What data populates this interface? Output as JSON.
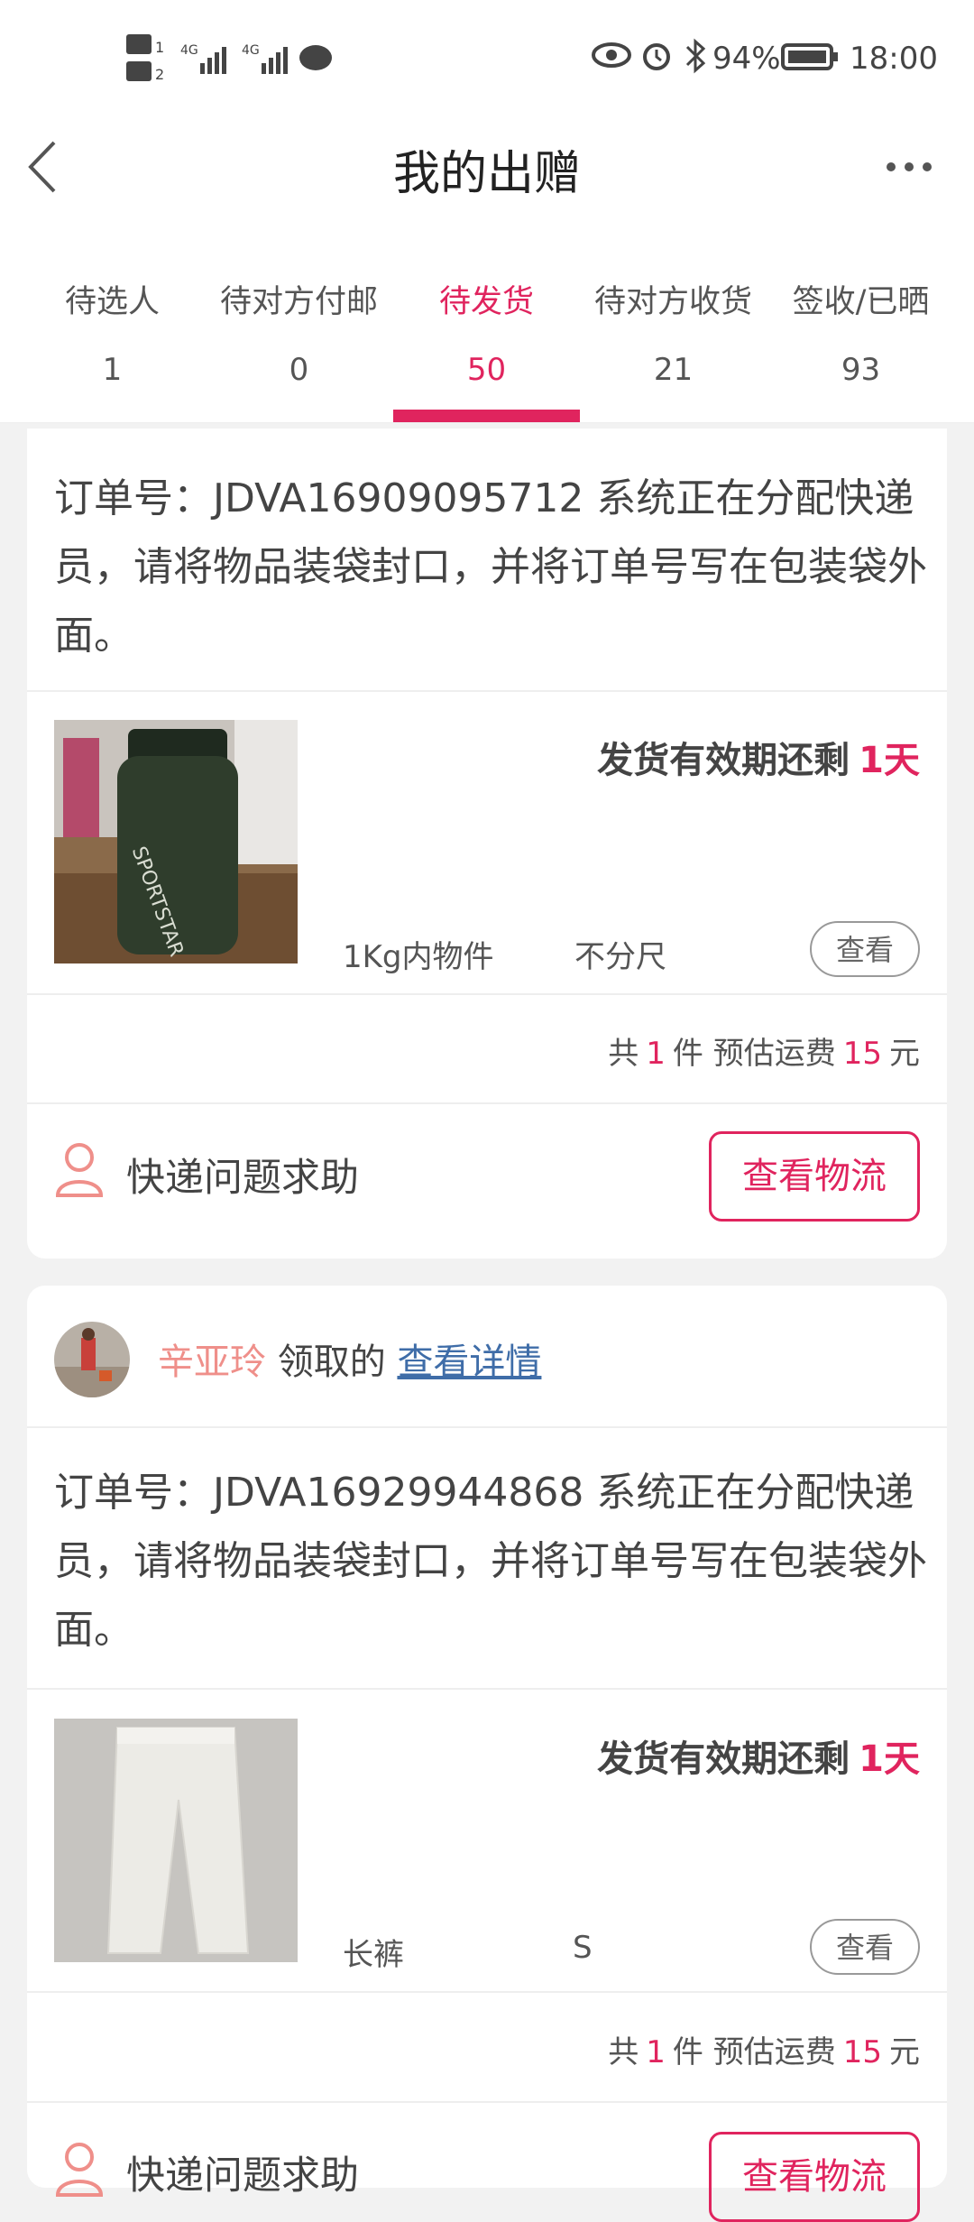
{
  "status_bar": {
    "network_left": "HD 4G 4G",
    "battery_percent": "94%",
    "time": "18:00"
  },
  "header": {
    "title": "我的出赠"
  },
  "tabs": [
    {
      "label": "待选人",
      "count": "1"
    },
    {
      "label": "待对方付邮",
      "count": "0"
    },
    {
      "label": "待发货",
      "count": "50",
      "active": true
    },
    {
      "label": "待对方收货",
      "count": "21"
    },
    {
      "label": "签收/已晒",
      "count": "93"
    }
  ],
  "orders": [
    {
      "order_text": "订单号：JDVA16909095712 系统正在分配快递员，请将物品装袋封口，并将订单号写在包装袋外面。",
      "expiry_label": "发货有效期还剩",
      "expiry_days": "1天",
      "spec_1": "1Kg内物件",
      "spec_2": "不分尺",
      "view_label": "查看",
      "summary_prefix": "共",
      "summary_qty": "1",
      "summary_mid": "件 预估运费",
      "summary_fee": "15",
      "summary_unit": "元",
      "help_label": "快递问题求助",
      "logistics_label": "查看物流"
    },
    {
      "claimer_name": "辛亚玲",
      "claim_text": "领取的",
      "claim_link": "查看详情",
      "order_text": "订单号：JDVA16929944868 系统正在分配快递员，请将物品装袋封口，并将订单号写在包装袋外面。",
      "expiry_label": "发货有效期还剩",
      "expiry_days": "1天",
      "spec_1": "长裤",
      "spec_2": "S",
      "view_label": "查看",
      "summary_prefix": "共",
      "summary_qty": "1",
      "summary_mid": "件 预估运费",
      "summary_fee": "15",
      "summary_unit": "元",
      "help_label": "快递问题求助",
      "logistics_label": "查看物流"
    }
  ],
  "colors": {
    "accent": "#e0245e",
    "link": "#3f6da8",
    "claimer_name": "#ef8f8a"
  }
}
